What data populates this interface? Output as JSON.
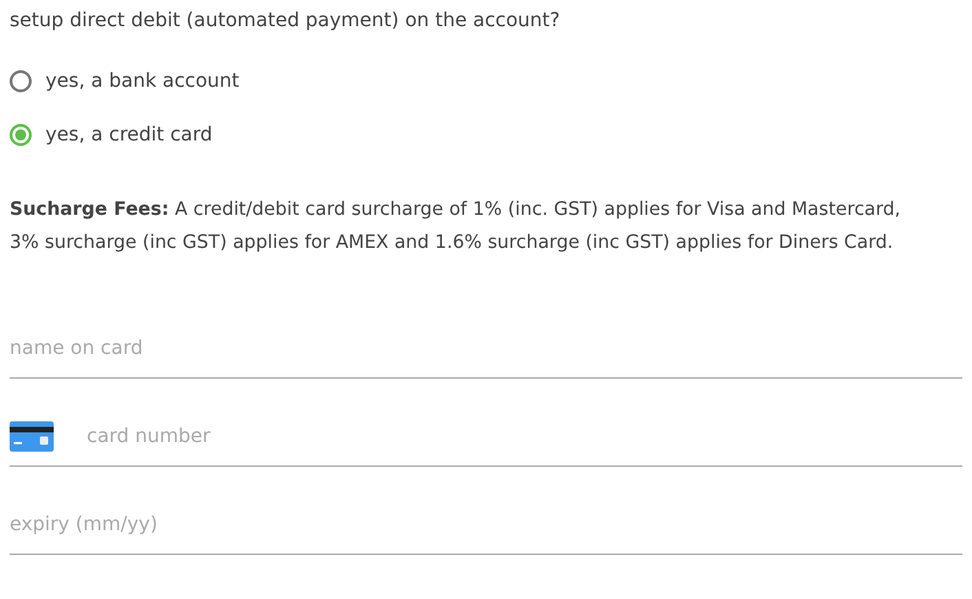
{
  "question": "setup direct debit (automated payment) on the account?",
  "options": [
    {
      "label": "yes, a bank account",
      "selected": false
    },
    {
      "label": "yes, a credit card",
      "selected": true
    }
  ],
  "notice": "**Sucharge Fees:** A credit/debit card surcharge of 1% (inc. GST) applies for Visa and Mastercard, 3% surcharge (inc GST) applies for AMEX and 1.6% surcharge (inc GST) applies for Diners Card.",
  "fields": [
    {
      "kind": "text",
      "placeholder": "name on card"
    },
    {
      "kind": "card",
      "placeholder": "card number"
    },
    {
      "kind": "text",
      "placeholder": "expiry (mm/yy)"
    }
  ]
}
